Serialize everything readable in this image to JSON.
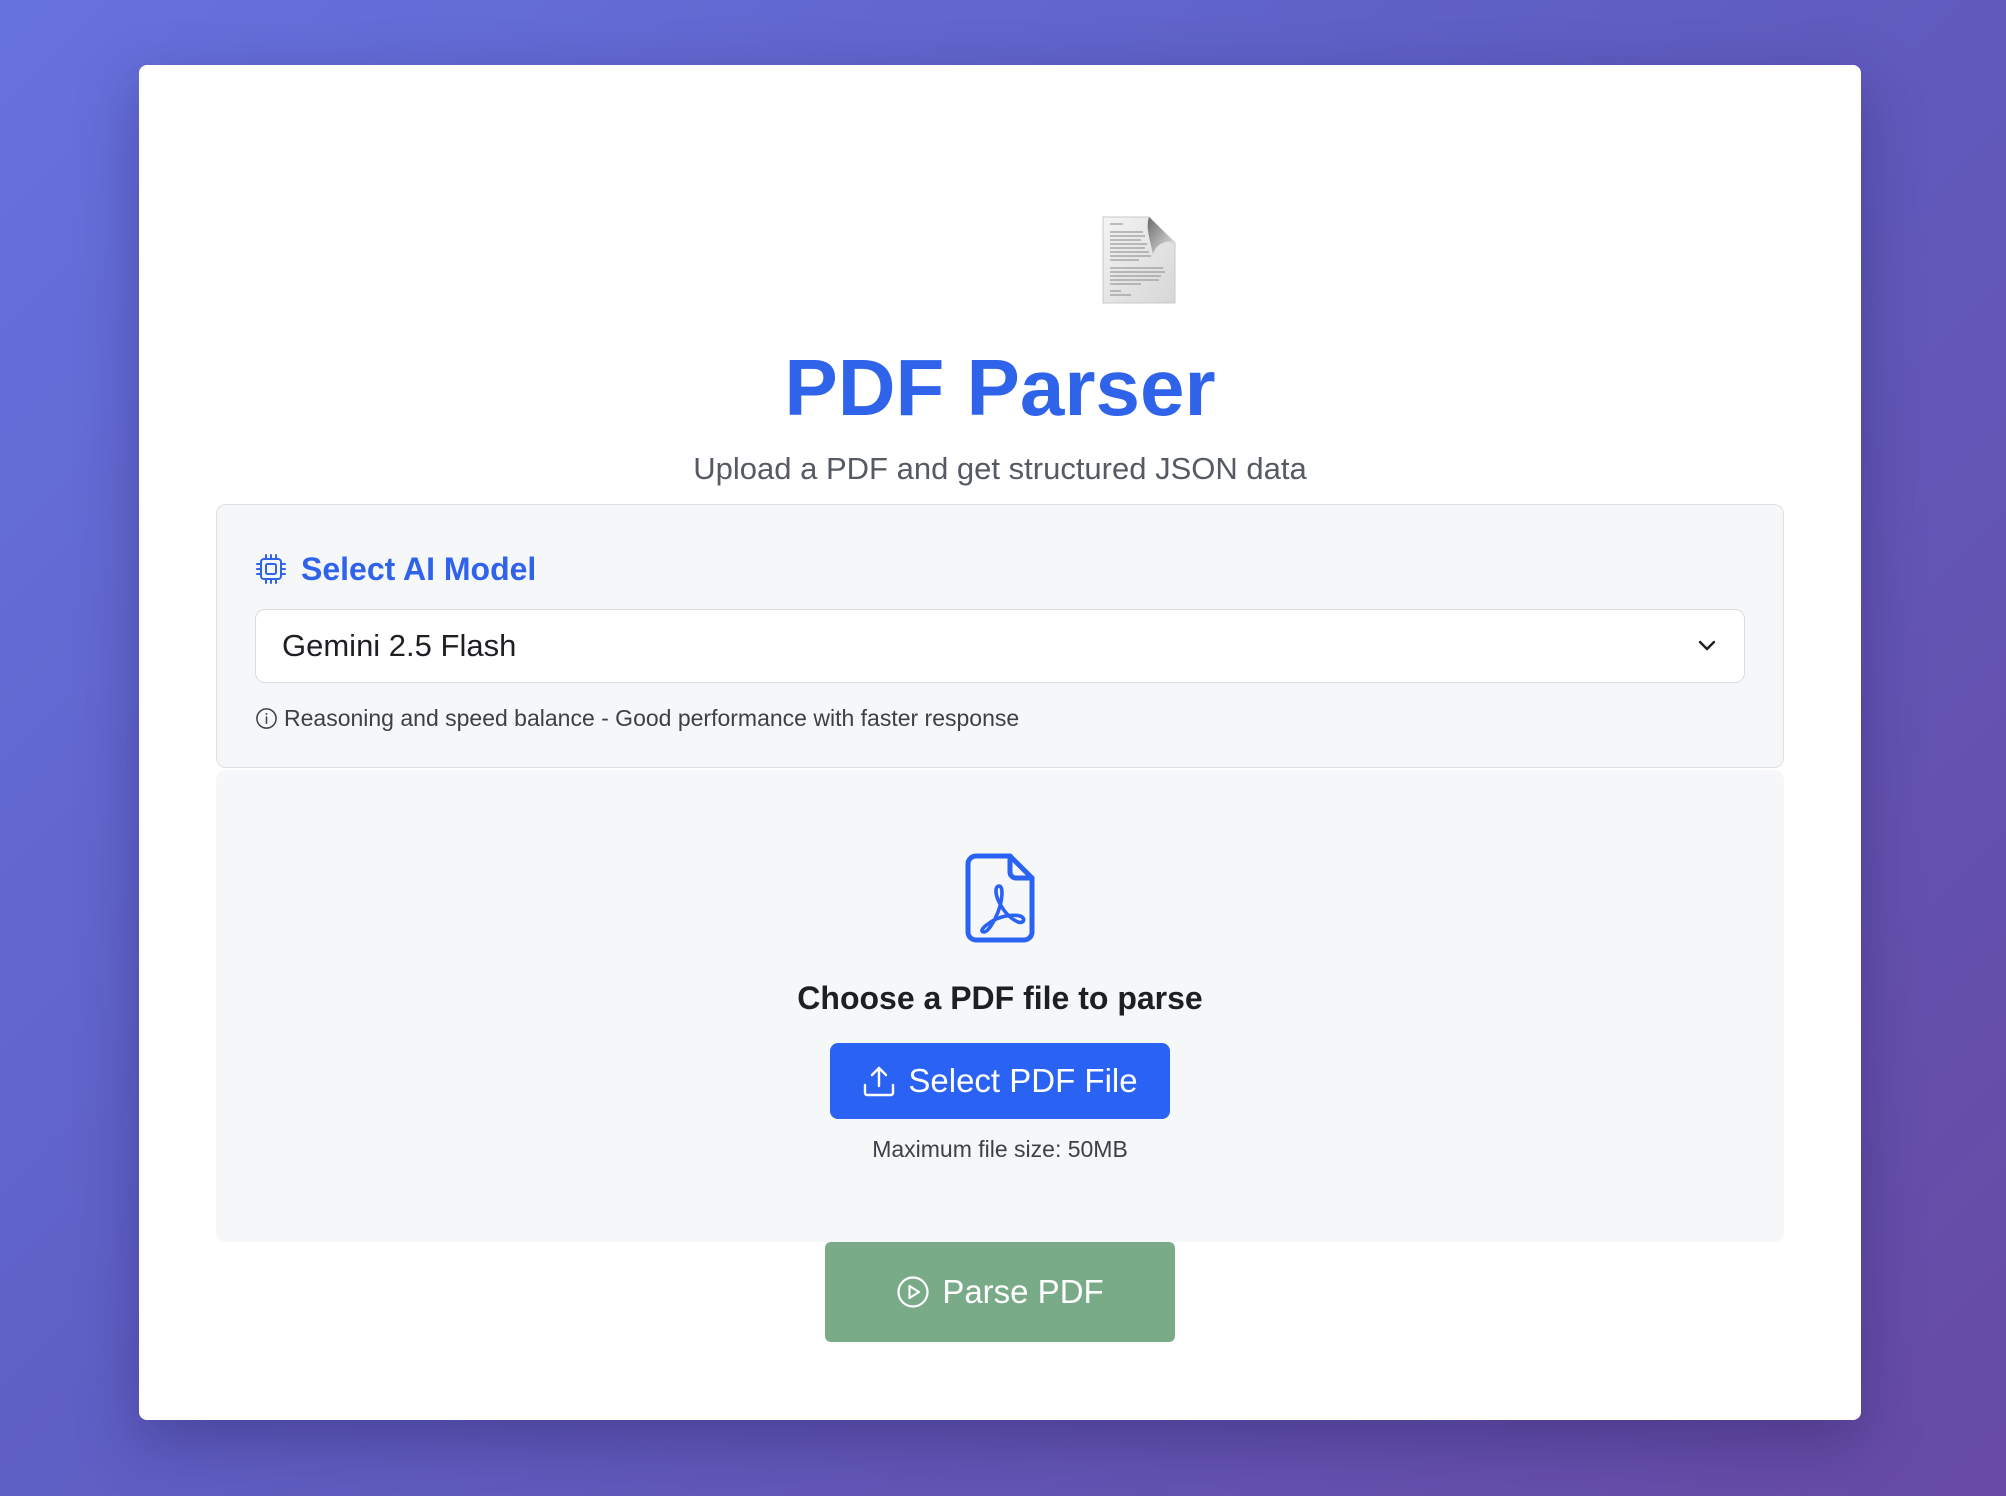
{
  "header": {
    "icon": "document-icon",
    "title": "PDF Parser",
    "subtitle": "Upload a PDF and get structured JSON data"
  },
  "model_selector": {
    "icon": "cpu-chip-icon",
    "label": "Select AI Model",
    "selected_value": "Gemini 2.5 Flash",
    "description_icon": "info-icon",
    "description": "Reasoning and speed balance - Good performance with faster response"
  },
  "upload": {
    "icon": "pdf-file-icon",
    "heading": "Choose a PDF file to parse",
    "button_icon": "upload-icon",
    "button_label": "Select PDF File",
    "max_size_note": "Maximum file size: 50MB"
  },
  "actions": {
    "parse_icon": "play-circle-icon",
    "parse_label": "Parse PDF",
    "parse_enabled": false
  },
  "colors": {
    "accent": "#2f63ea",
    "primary_button": "#2a63f4",
    "disabled_parse_button": "#7aab89",
    "background_gradient_start": "#6672de",
    "background_gradient_end": "#674aa3"
  }
}
